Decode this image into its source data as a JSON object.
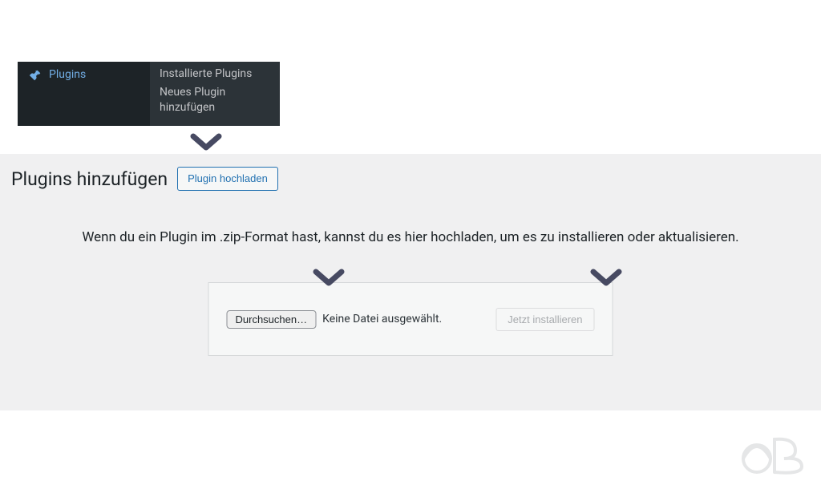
{
  "admin_menu": {
    "main_label": "Plugins",
    "submenu": {
      "installed": "Installierte Plugins",
      "add_new": "Neues Plugin hinzufügen"
    }
  },
  "page": {
    "title": "Plugins hinzufügen",
    "upload_button": "Plugin hochladen",
    "instruction": "Wenn du ein Plugin im .zip-Format hast, kannst du es hier hochladen, um es zu installieren oder aktualisieren."
  },
  "upload_form": {
    "browse_label": "Durchsuchen…",
    "file_status": "Keine Datei ausgewählt.",
    "install_label": "Jetzt installieren"
  },
  "colors": {
    "accent": "#2271b1",
    "menu_highlight": "#72aee6",
    "chevron": "#474a62"
  }
}
